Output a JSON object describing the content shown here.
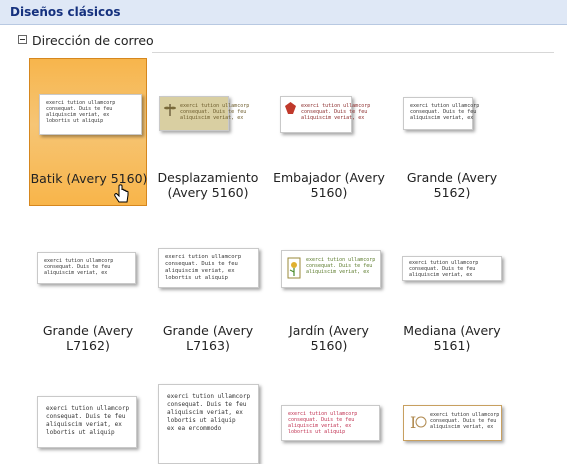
{
  "header": {
    "title": "Diseños clásicos"
  },
  "section": {
    "label": "Dirección de correo"
  },
  "sample_lines": [
    "exerci tution ullamcorp",
    "consequat. Duis te feu",
    "aliquiscim veriat, ex",
    "lobortis ut aliquip",
    "ex ea ercommodo"
  ],
  "tiles": [
    {
      "label": "Batik (Avery 5160)",
      "selected": true
    },
    {
      "label": "Desplazamiento (Avery 5160)"
    },
    {
      "label": "Embajador (Avery 5160)"
    },
    {
      "label": "Grande (Avery 5162)"
    },
    {
      "label": "Grande (Avery L7162)"
    },
    {
      "label": "Grande (Avery L7163)"
    },
    {
      "label": "Jardín (Avery 5160)"
    },
    {
      "label": "Mediana (Avery 5161)"
    }
  ],
  "colors": {
    "selected": "#f7b54c",
    "header": "#dfe8f6",
    "title": "#15317e"
  },
  "icons": {
    "collapse": "minus-box-icon",
    "cursor": "hand-pointer-icon"
  }
}
